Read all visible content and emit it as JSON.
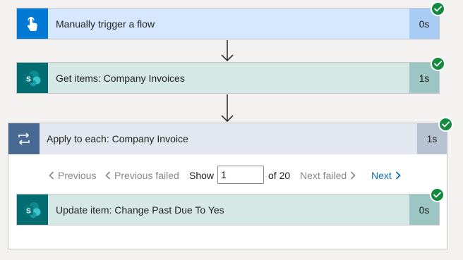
{
  "flow": {
    "trigger": {
      "label": "Manually trigger a flow",
      "duration": "0s",
      "icon": "touch-hand-icon",
      "status": "succeeded"
    },
    "get_items": {
      "label": "Get items: Company Invoices",
      "duration": "1s",
      "icon": "sharepoint-icon",
      "status": "succeeded"
    },
    "apply_to_each": {
      "label": "Apply to each: Company Invoice",
      "duration": "1s",
      "icon": "loop-icon",
      "status": "succeeded",
      "pager": {
        "previous_label": "Previous",
        "previous_failed_label": "Previous failed",
        "show_label": "Show",
        "current_page": "1",
        "of_label": "of 20",
        "next_failed_label": "Next failed",
        "next_label": "Next"
      },
      "update_item": {
        "label": "Update item: Change Past Due To Yes",
        "duration": "0s",
        "icon": "sharepoint-icon",
        "status": "succeeded"
      }
    }
  },
  "colors": {
    "success": "#138a3d",
    "link": "#0f6cbd",
    "trigger_accent": "#0078d4",
    "sharepoint_accent": "#036c70",
    "loop_accent": "#486991"
  }
}
